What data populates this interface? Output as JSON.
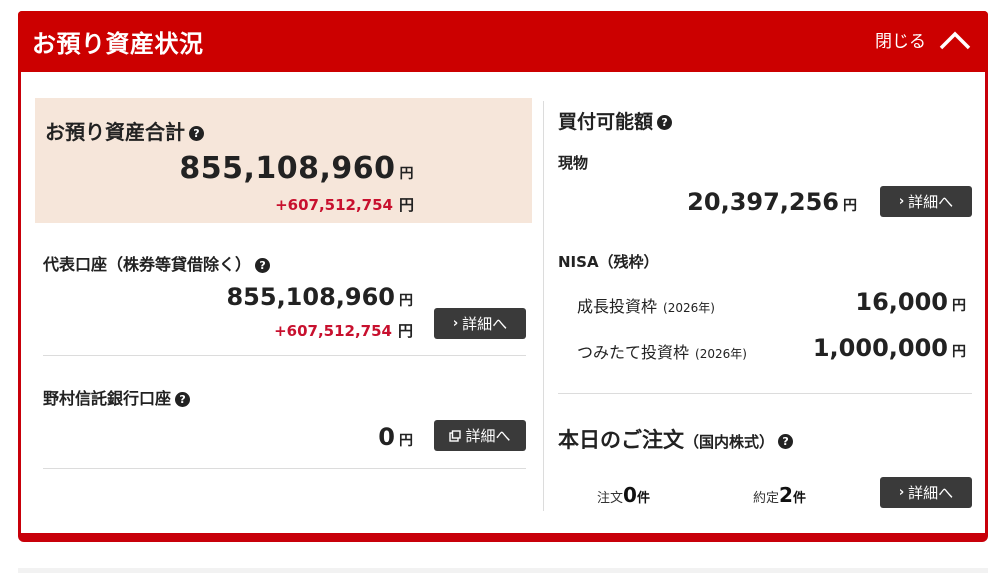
{
  "header": {
    "title": "お預り資産状況",
    "close_label": "閉じる",
    "colors": {
      "header_bg": "#cc0000",
      "button_bg": "#3a3a3a",
      "diff_red": "#c8102e",
      "total_bg": "#f6e6da"
    }
  },
  "total": {
    "title": "お預り資産合計",
    "amount": "855,108,960",
    "yen": "円",
    "diff": "+607,512,754",
    "diff_yen": "円"
  },
  "representative": {
    "title": "代表口座（株券等貸借除く）",
    "amount": "855,108,960",
    "yen": "円",
    "diff": "+607,512,754",
    "diff_yen": "円",
    "detail_label": "詳細へ",
    "detail_icon": "chevron-right-icon"
  },
  "trust_bank": {
    "title": "野村信託銀行口座",
    "amount": "0",
    "yen": "円",
    "detail_label": "詳細へ",
    "detail_icon": "external-window-icon"
  },
  "buying_power": {
    "title": "買付可能額",
    "cash_label": "現物",
    "cash_amount": "20,397,256",
    "yen": "円",
    "detail_label": "詳細へ"
  },
  "nisa": {
    "title": "NISA（残枠）",
    "growth_label": "成長投資枠",
    "growth_year": "(2026年)",
    "growth_amount": "16,000",
    "tsumitate_label": "つみたて投資枠",
    "tsumitate_year": "(2026年)",
    "tsumitate_amount": "1,000,000",
    "yen": "円"
  },
  "orders": {
    "title": "本日のご注文",
    "subtitle": "（国内株式）",
    "order_label": "注文",
    "order_count": "0",
    "filled_label": "約定",
    "filled_count": "2",
    "unit": "件",
    "detail_label": "詳細へ"
  }
}
